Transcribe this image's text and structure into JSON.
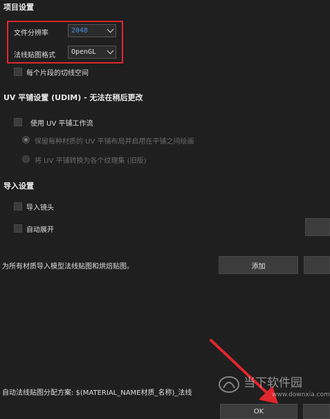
{
  "project": {
    "heading": "项目设置",
    "resolution_label": "文件分辨率",
    "resolution_value": "2048",
    "normal_format_label": "法线贴图格式",
    "normal_format_value": "OpenGL",
    "tangent_label": "每个片段的切线空间"
  },
  "uv": {
    "heading": "UV 平铺设置 (UDIM) - 无法在稍后更改",
    "use_label": "使用 UV 平铺工作流",
    "option1_label": "保留每种材质的 UV 平铺布局并启用在平铺之间绘画",
    "option2_label": "将 UV 平铺转换为各个纹理集 (旧版)"
  },
  "import": {
    "heading": "导入设置",
    "cameras_label": "导入镜头",
    "auto_unwrap_label": "自动展开",
    "bake_text": "为所有材质导入模型法线贴图和烘焙贴图。",
    "add_button": "添加"
  },
  "bottom": {
    "assign_text": "自动法线贴图分配方案: $(MATERIAL_NAME材质_名称)_法线",
    "ok_button": "OK"
  },
  "watermark": {
    "text": "当下软件园",
    "url": "www.downxia.com"
  },
  "colors": {
    "background": "#1f1f1f",
    "accent_value": "#4a90e2",
    "highlight": "#e0262d"
  }
}
